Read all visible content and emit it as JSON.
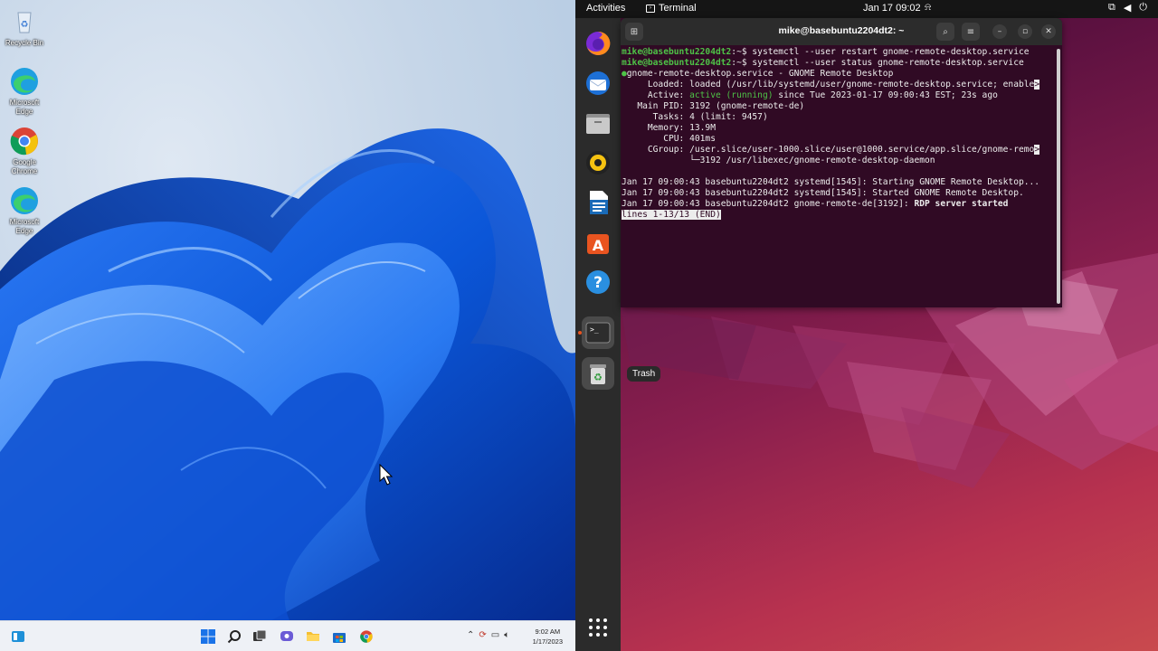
{
  "windows": {
    "desktop_icons": [
      {
        "label": "Recycle Bin",
        "icon": "recycle-bin-icon"
      },
      {
        "label": "Microsoft Edge",
        "icon": "edge-icon"
      },
      {
        "label": "Google Chrome",
        "icon": "chrome-icon"
      },
      {
        "label": "Microsoft Edge",
        "icon": "edge-icon"
      }
    ],
    "taskbar": {
      "clock_time": "9:02 AM",
      "clock_date": "1/17/2023"
    }
  },
  "ubuntu": {
    "topbar": {
      "activities": "Activities",
      "app_name": "Terminal",
      "clock": "Jan 17  09:02"
    },
    "trash_tooltip": "Trash",
    "terminal": {
      "title": "mike@basebuntu2204dt2: ~",
      "prompt_user": "mike@basebuntu2204dt2",
      "prompt_suffix": ":~$",
      "cmd1": " systemctl --user restart gnome-remote-desktop.service",
      "cmd2": " systemctl --user status gnome-remote-desktop.service",
      "status_header": "gnome-remote-desktop.service - GNOME Remote Desktop",
      "loaded": "     Loaded: loaded (/usr/lib/systemd/user/gnome-remote-desktop.service; enable",
      "active_label": "     Active: ",
      "active_state": "active (running)",
      "active_rest": " since Tue 2023-01-17 09:00:43 EST; 23s ago",
      "main_pid": "   Main PID: 3192 (gnome-remote-de)",
      "tasks": "      Tasks: 4 (limit: 9457)",
      "memory": "     Memory: 13.9M",
      "cpu": "        CPU: 401ms",
      "cgroup": "     CGroup: /user.slice/user-1000.slice/user@1000.service/app.slice/gnome-remo",
      "cgroup2": "             └─3192 /usr/libexec/gnome-remote-desktop-daemon",
      "log1": "Jan 17 09:00:43 basebuntu2204dt2 systemd[1545]: Starting GNOME Remote Desktop...",
      "log2": "Jan 17 09:00:43 basebuntu2204dt2 systemd[1545]: Started GNOME Remote Desktop.",
      "log3_pre": "Jan 17 09:00:43 basebuntu2204dt2 gnome-remote-de[3192]: ",
      "log3_bold": "RDP server started",
      "pager": "lines 1-13/13 (END)"
    }
  },
  "colors": {
    "terminal_bg": "#300a24",
    "prompt_green": "#4ec247",
    "ubuntu_orange": "#e95420",
    "win_accent": "#1a5fe0"
  }
}
